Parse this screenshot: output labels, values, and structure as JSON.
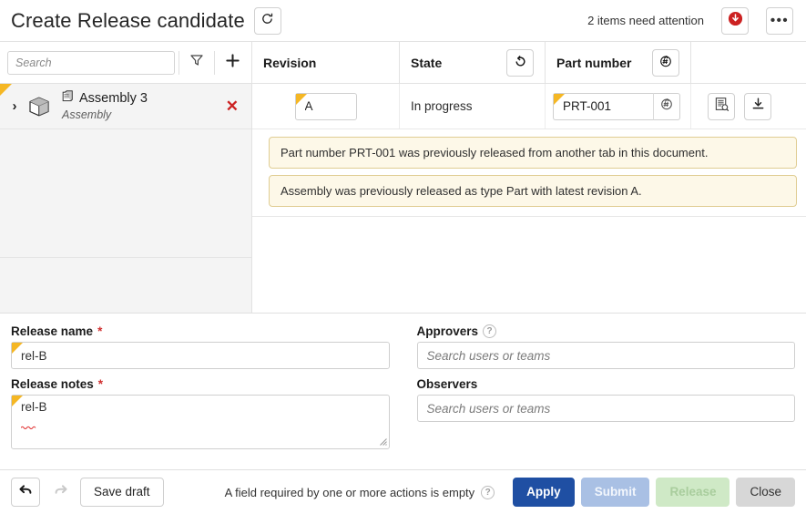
{
  "header": {
    "title": "Create Release candidate",
    "refresh_icon": "revision-refresh-icon",
    "attention_text": "2 items need attention",
    "alert_icon": "alert-down-circle-icon",
    "overflow_label": "•••"
  },
  "tree_toolbar": {
    "search_placeholder": "Search",
    "search_value": "",
    "filter_icon": "filter-funnel-icon",
    "add_icon": "plus-icon"
  },
  "columns": {
    "revision": "Revision",
    "state": "State",
    "state_icon": "refresh-revision-icon",
    "part_number": "Part number",
    "part_number_icon": "auto-number-icon"
  },
  "tree": {
    "rows": [
      {
        "expand_icon": "chevron-right-icon",
        "item_icon": "cube-icon",
        "doc_icon": "document-icon",
        "name": "Assembly 3",
        "subtitle": "Assembly",
        "remove_icon": "remove-x-icon",
        "remove_label": "✕"
      }
    ]
  },
  "detail": {
    "revision_value": "A",
    "state_value": "In progress",
    "part_number_value": "PRT-001",
    "part_number_btn_icon": "auto-number-icon",
    "properties_icon": "properties-list-icon",
    "download_icon": "download-icon"
  },
  "banners": [
    {
      "text": "Part number PRT-001 was previously released from another tab in this document."
    },
    {
      "text": "Assembly was previously released as type Part with latest revision A."
    }
  ],
  "form": {
    "release_name_label": "Release name",
    "release_name_required": "*",
    "release_name_value": "rel-B",
    "release_notes_label": "Release notes",
    "release_notes_required": "*",
    "release_notes_value": "rel-B",
    "approvers_label": "Approvers",
    "approvers_help_icon": "help-circle-icon",
    "approvers_help_label": "?",
    "approvers_placeholder": "Search users or teams",
    "approvers_value": "",
    "observers_label": "Observers",
    "observers_placeholder": "Search users or teams",
    "observers_value": ""
  },
  "footer": {
    "undo_icon": "undo-arrow-icon",
    "redo_icon": "redo-arrow-icon",
    "save_draft_label": "Save draft",
    "message": "A field required by one or more actions is empty",
    "message_help_icon": "help-circle-icon",
    "message_help_label": "?",
    "apply_label": "Apply",
    "submit_label": "Submit",
    "release_label": "Release",
    "close_label": "Close"
  },
  "colors": {
    "accent_blue": "#1f4fa3",
    "flag_yellow": "#f5b724",
    "alert_red": "#cc2222",
    "banner_bg": "#fdf8e8",
    "banner_border": "#e0cd93",
    "panel_grey": "#f4f4f4"
  }
}
